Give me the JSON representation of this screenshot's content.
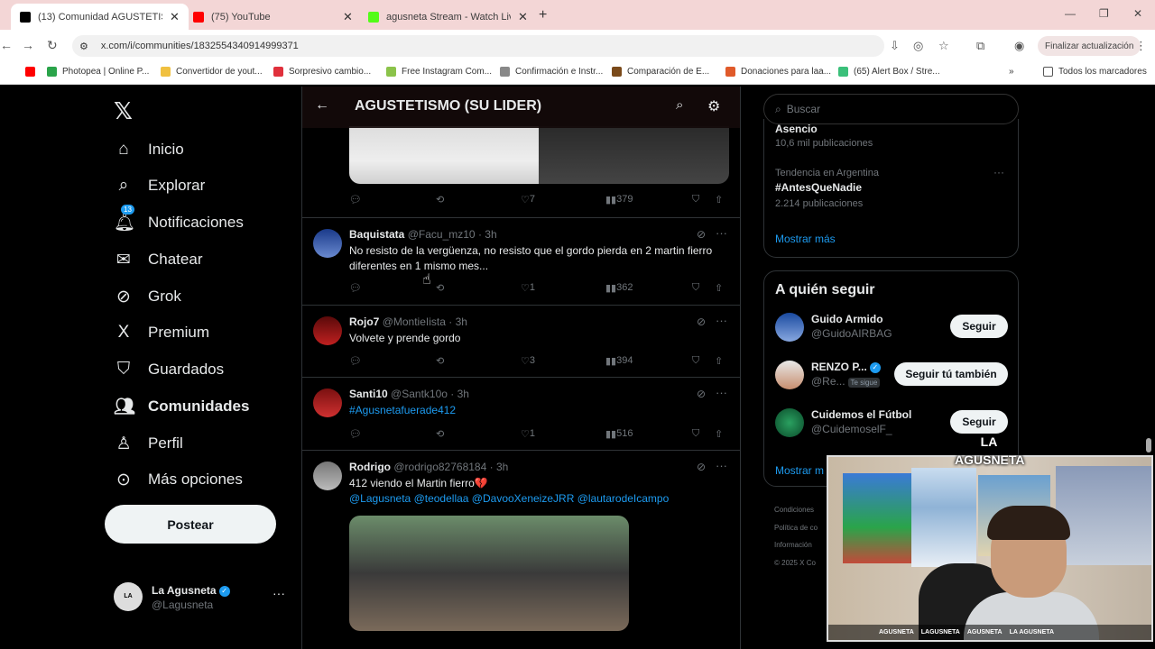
{
  "browser": {
    "tabs": [
      {
        "label": "(13) Comunidad AGUSTETISMO",
        "color": "#000000"
      },
      {
        "label": "(75) YouTube",
        "color": "#ff0000"
      },
      {
        "label": "agusneta Stream - Watch Live o",
        "color": "#53fc18"
      }
    ],
    "url": "x.com/i/communities/1832554340914999371",
    "update_button": "Finalizar actualización",
    "bookmarks": [
      "Photopea | Online P...",
      "Convertidor de yout...",
      "Sorpresivo cambio...",
      "Free Instagram Com...",
      "Confirmación e Instr...",
      "Comparación de E...",
      "Donaciones para laa...",
      "(65) Alert Box / Stre..."
    ],
    "all_bookmarks": "Todos los marcadores"
  },
  "sidebar": {
    "items": [
      {
        "label": "Inicio",
        "icon": "home-icon"
      },
      {
        "label": "Explorar",
        "icon": "search-icon"
      },
      {
        "label": "Notificaciones",
        "icon": "bell-icon",
        "badge": "13"
      },
      {
        "label": "Chatear",
        "icon": "mail-icon"
      },
      {
        "label": "Grok",
        "icon": "grok-icon"
      },
      {
        "label": "Premium",
        "icon": "x-premium-icon"
      },
      {
        "label": "Guardados",
        "icon": "bookmark-icon"
      },
      {
        "label": "Comunidades",
        "icon": "communities-icon"
      },
      {
        "label": "Perfil",
        "icon": "person-icon"
      },
      {
        "label": "Más opciones",
        "icon": "more-circle-icon"
      }
    ],
    "post_button": "Postear",
    "profile": {
      "name": "La Agusneta",
      "handle": "@Lagusneta",
      "avatar_text": "LA AGUSNETA"
    }
  },
  "feed": {
    "title": "AGUSTETISMO (SU LIDER)",
    "top_post_actions": {
      "likes": "7",
      "views": "379"
    },
    "posts": [
      {
        "name": "Baquistata",
        "handle": "@Facu_mz10",
        "time": "· 3h",
        "text": "No resisto de la vergüenza, no resisto que el gordo pierda en 2 martin fierro diferentes en 1 mismo mes...",
        "likes": "1",
        "views": "362"
      },
      {
        "name": "Rojo7",
        "handle": "@MontieIista",
        "time": "· 3h",
        "text": "Volvete y prende gordo",
        "likes": "3",
        "views": "394"
      },
      {
        "name": "Santi10",
        "handle": "@Santk10o",
        "time": "· 3h",
        "hashtag": "#Agusnetafuerade412",
        "likes": "1",
        "views": "516"
      },
      {
        "name": "Rodrigo",
        "handle": "@rodrigo82768184",
        "time": "· 3h",
        "text": "412 viendo el Martin fierro💔",
        "mentions": "@Lagusneta @teodellaa @DavooXeneizeJRR @lautarodeIcampo"
      }
    ]
  },
  "right": {
    "search_placeholder": "Buscar",
    "trend_partial": {
      "title": "Asencio",
      "count": "10,6 mil publicaciones"
    },
    "trend": {
      "context": "Tendencia en Argentina",
      "title": "#AntesQueNadie",
      "count": "2.214 publicaciones"
    },
    "show_more": "Mostrar más",
    "who_to_follow": {
      "title": "A quién seguir",
      "users": [
        {
          "name": "Guido Armido",
          "handle": "@GuidoAIRBAG",
          "button": "Seguir"
        },
        {
          "name": "RENZO P...",
          "handle": "@Re...",
          "follows_you": "Te sigue",
          "button": "Seguir tú también"
        },
        {
          "name": "Cuidemos el Fútbol",
          "handle": "@CuidemoselF_",
          "button": "Seguir"
        }
      ],
      "show_more": "Mostrar m"
    },
    "footer": [
      "Condiciones",
      "Política de co",
      "Información",
      "© 2025 X Co"
    ]
  },
  "overlay": {
    "logo": "LA AGUSNETA",
    "socials": [
      "AGUSNETA",
      "LAGUSNETA",
      "AGUSNETA",
      "LA AGUSNETA"
    ]
  }
}
